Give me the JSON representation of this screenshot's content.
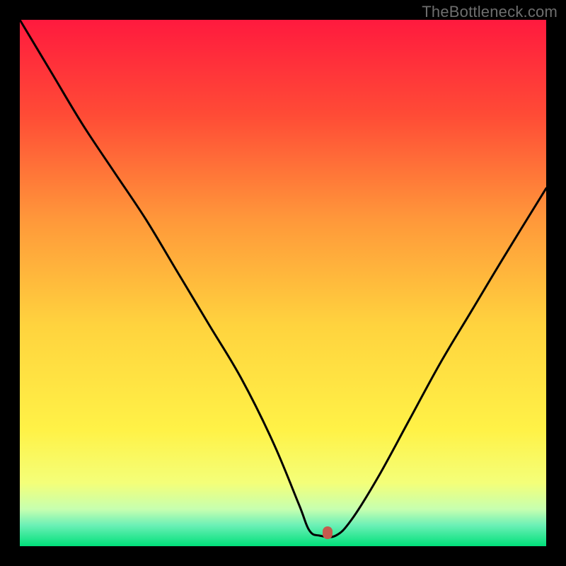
{
  "watermark": "TheBottleneck.com",
  "marker": {
    "color": "#c65a4e",
    "x_pct": 58.5,
    "y_pct": 97.5
  },
  "chart_data": {
    "type": "line",
    "title": "",
    "xlabel": "",
    "ylabel": "",
    "xlim": [
      0,
      100
    ],
    "ylim": [
      0,
      100
    ],
    "annotations": [
      "TheBottleneck.com"
    ],
    "background_gradient": {
      "stops": [
        {
          "pct": 0,
          "color": "#ff1a3e"
        },
        {
          "pct": 18,
          "color": "#ff4b36"
        },
        {
          "pct": 38,
          "color": "#ff983a"
        },
        {
          "pct": 58,
          "color": "#ffd33e"
        },
        {
          "pct": 78,
          "color": "#fff247"
        },
        {
          "pct": 88,
          "color": "#f4ff79"
        },
        {
          "pct": 93,
          "color": "#c6ffb0"
        },
        {
          "pct": 96,
          "color": "#6cf0b6"
        },
        {
          "pct": 100,
          "color": "#00e07a"
        }
      ]
    },
    "series": [
      {
        "name": "bottleneck-curve",
        "color": "#000000",
        "x": [
          0,
          6,
          12,
          18,
          24,
          30,
          36,
          42,
          48,
          53,
          55,
          57,
          60,
          63,
          68,
          74,
          80,
          86,
          92,
          100
        ],
        "y": [
          100,
          90,
          80,
          71,
          62,
          52,
          42,
          32,
          20,
          8,
          3,
          2,
          2,
          5,
          13,
          24,
          35,
          45,
          55,
          68
        ]
      }
    ],
    "marker_point": {
      "x": 58.5,
      "y": 2.5,
      "color": "#c65a4e"
    }
  }
}
